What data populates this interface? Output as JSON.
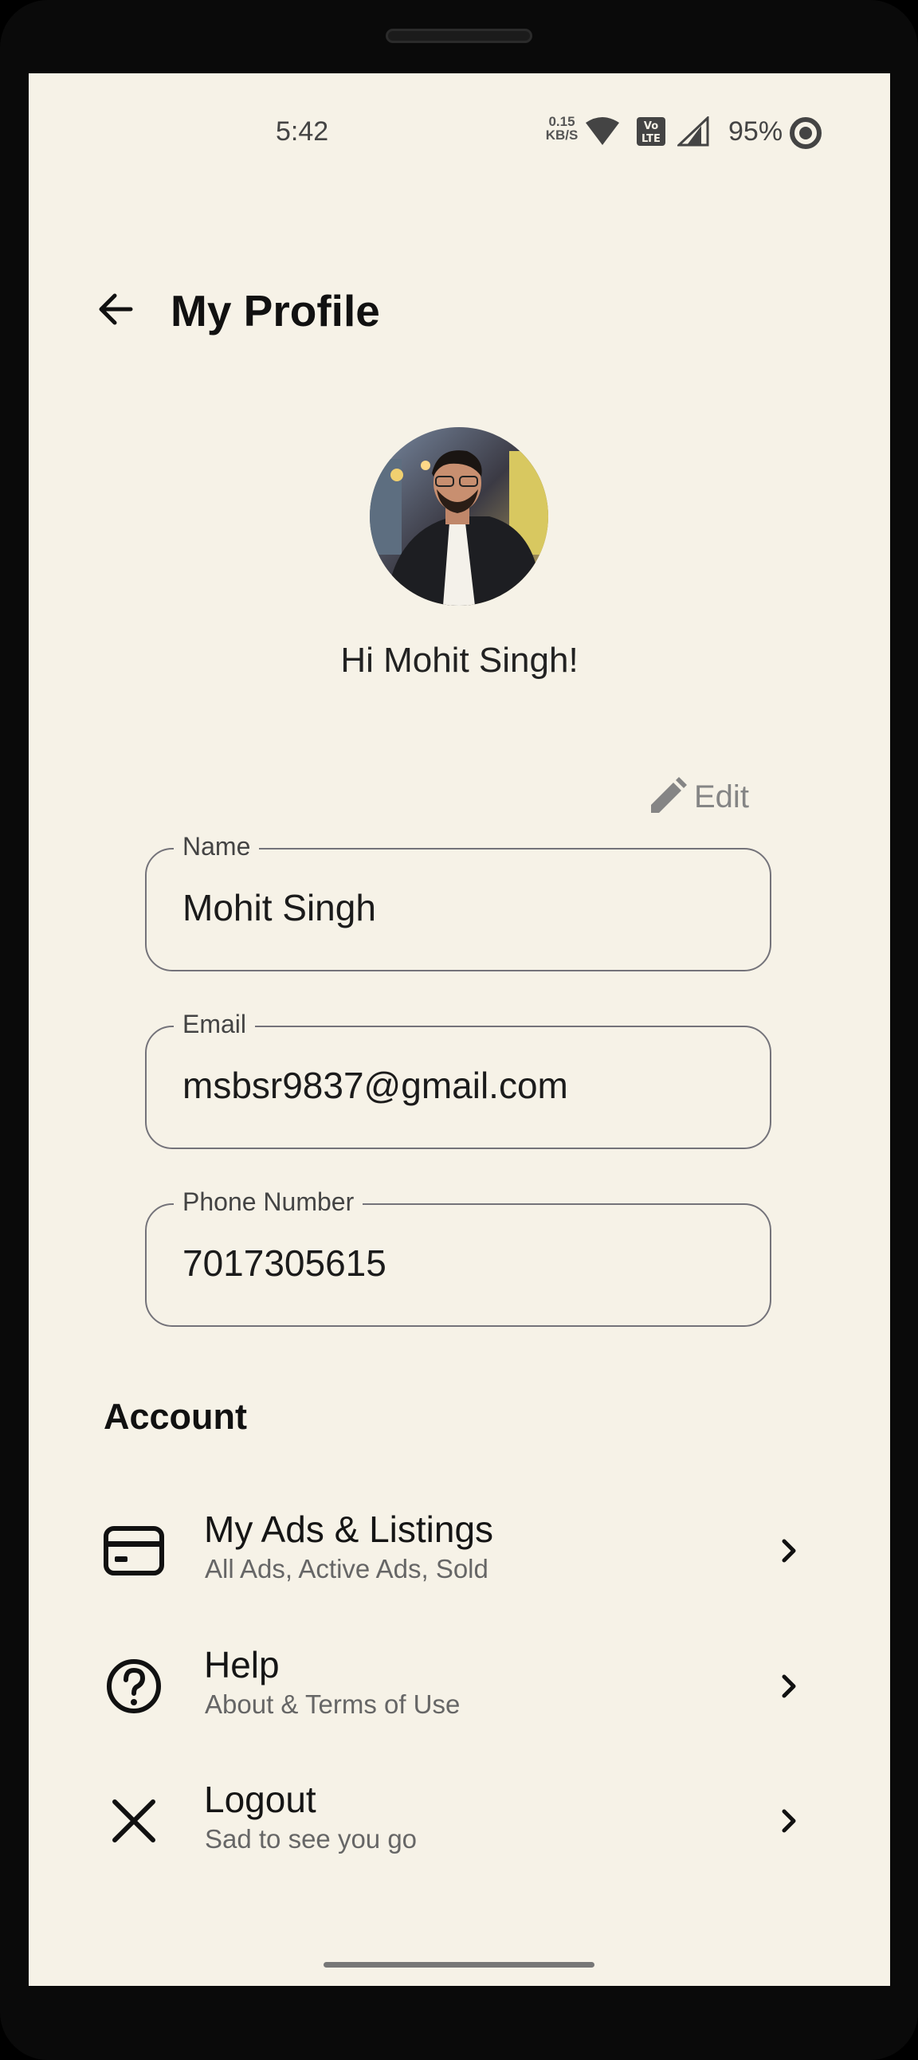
{
  "status_bar": {
    "time": "5:42",
    "network_speed_value": "0.15",
    "network_speed_unit": "KB/S",
    "battery": "95%",
    "icons": [
      "wifi-icon",
      "volte-icon",
      "cellular-signal-icon",
      "battery-saver-icon"
    ]
  },
  "header": {
    "title": "My Profile",
    "back_icon": "arrow-left-icon"
  },
  "profile": {
    "greeting": "Hi Mohit Singh!",
    "edit_label": "Edit",
    "edit_icon": "pencil-icon"
  },
  "fields": {
    "name": {
      "label": "Name",
      "value": "Mohit Singh"
    },
    "email": {
      "label": "Email",
      "value": "msbsr9837@gmail.com"
    },
    "phone": {
      "label": "Phone Number",
      "value": "7017305615"
    }
  },
  "account": {
    "heading": "Account",
    "items": [
      {
        "title": "My Ads & Listings",
        "subtitle": "All Ads, Active Ads, Sold",
        "icon": "credit-card-icon"
      },
      {
        "title": "Help",
        "subtitle": "About & Terms of Use",
        "icon": "help-circle-icon"
      },
      {
        "title": "Logout",
        "subtitle": "Sad to see you go",
        "icon": "close-icon"
      }
    ]
  },
  "colors": {
    "background": "#f6f2e7",
    "text": "#111111",
    "muted": "#858585",
    "field_border": "#74737a"
  }
}
